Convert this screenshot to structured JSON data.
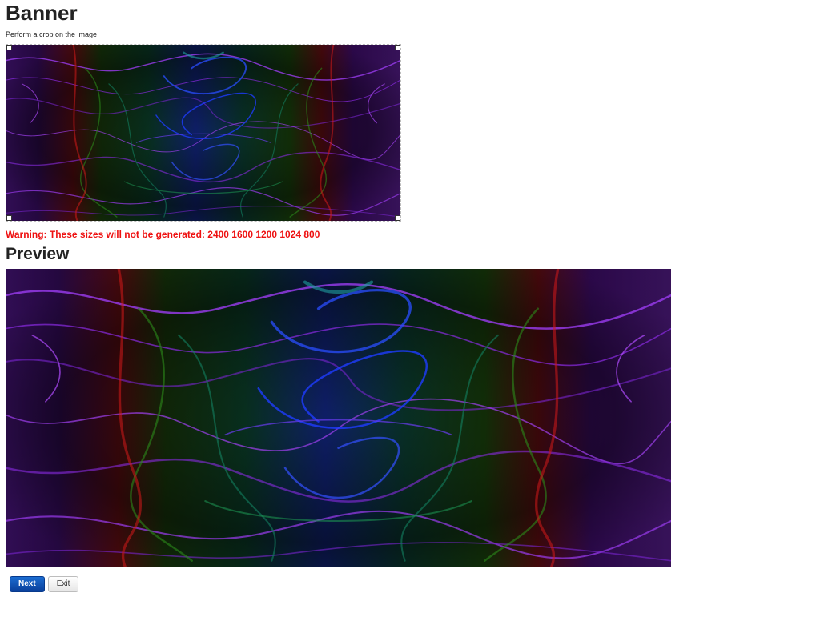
{
  "page": {
    "title": "Banner",
    "subtitle": "Perform a crop on the image",
    "warning": "Warning: These sizes will not be generated: 2400 1600 1200 1024 800",
    "preview_heading": "Preview"
  },
  "buttons": {
    "next_label": "Next",
    "exit_label": "Exit"
  },
  "colors": {
    "warning": "#ee1111",
    "primary_button": "#0a3f9a",
    "image_purple": "#8a2be2",
    "image_blue": "#1e3cff",
    "image_green": "#1a8a1a",
    "image_red": "#d11a1a"
  },
  "images": {
    "crop_source": "abstract-swirl-image",
    "preview": "abstract-swirl-image"
  }
}
